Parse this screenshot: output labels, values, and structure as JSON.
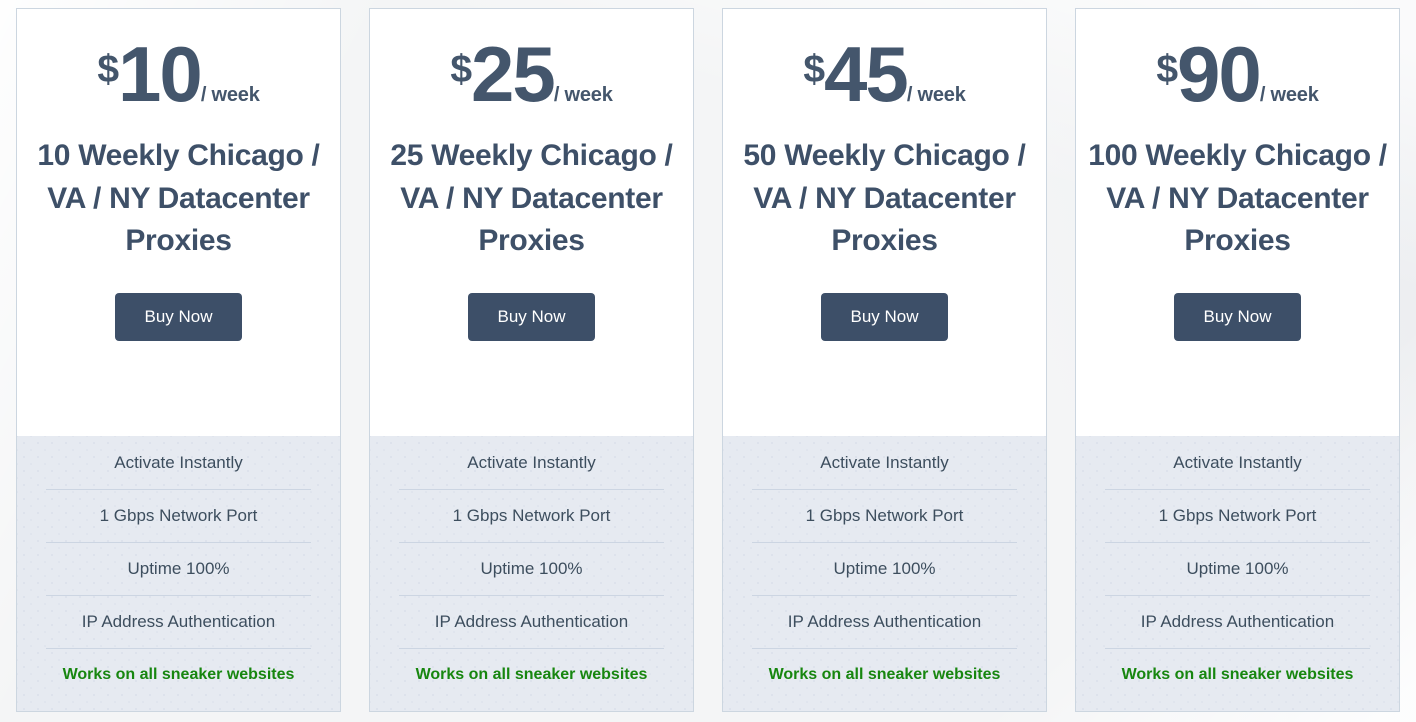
{
  "theme": {
    "page_background": "#f4f5f6",
    "card_background": "#ffffff",
    "card_border": "#ccd6e0",
    "features_background": "#e6eaf1",
    "price_color": "#44566c",
    "title_color": "#3e5068",
    "button_background": "#3d4f68",
    "button_text": "#ffffff",
    "feature_text": "#3d4e5e",
    "highlight_color": "#17860f",
    "divider_color": "#ccd5e2"
  },
  "plans": [
    {
      "currency": "$",
      "amount": "10",
      "period": "/ week",
      "title": "10 Weekly Chicago / VA / NY Datacenter Proxies",
      "buy_label": "Buy Now",
      "features": [
        "Activate Instantly",
        "1 Gbps Network Port",
        "Uptime 100%",
        "IP Address Authentication",
        "Works on all sneaker websites"
      ]
    },
    {
      "currency": "$",
      "amount": "25",
      "period": "/ week",
      "title": "25 Weekly Chicago / VA / NY Datacenter Proxies",
      "buy_label": "Buy Now",
      "features": [
        "Activate Instantly",
        "1 Gbps Network Port",
        "Uptime 100%",
        "IP Address Authentication",
        "Works on all sneaker websites"
      ]
    },
    {
      "currency": "$",
      "amount": "45",
      "period": "/ week",
      "title": "50 Weekly Chicago / VA / NY Datacenter Proxies",
      "buy_label": "Buy Now",
      "features": [
        "Activate Instantly",
        "1 Gbps Network Port",
        "Uptime 100%",
        "IP Address Authentication",
        "Works on all sneaker websites"
      ]
    },
    {
      "currency": "$",
      "amount": "90",
      "period": "/ week",
      "title": "100 Weekly Chicago / VA / NY Datacenter Proxies",
      "buy_label": "Buy Now",
      "features": [
        "Activate Instantly",
        "1 Gbps Network Port",
        "Uptime 100%",
        "IP Address Authentication",
        "Works on all sneaker websites"
      ]
    }
  ]
}
